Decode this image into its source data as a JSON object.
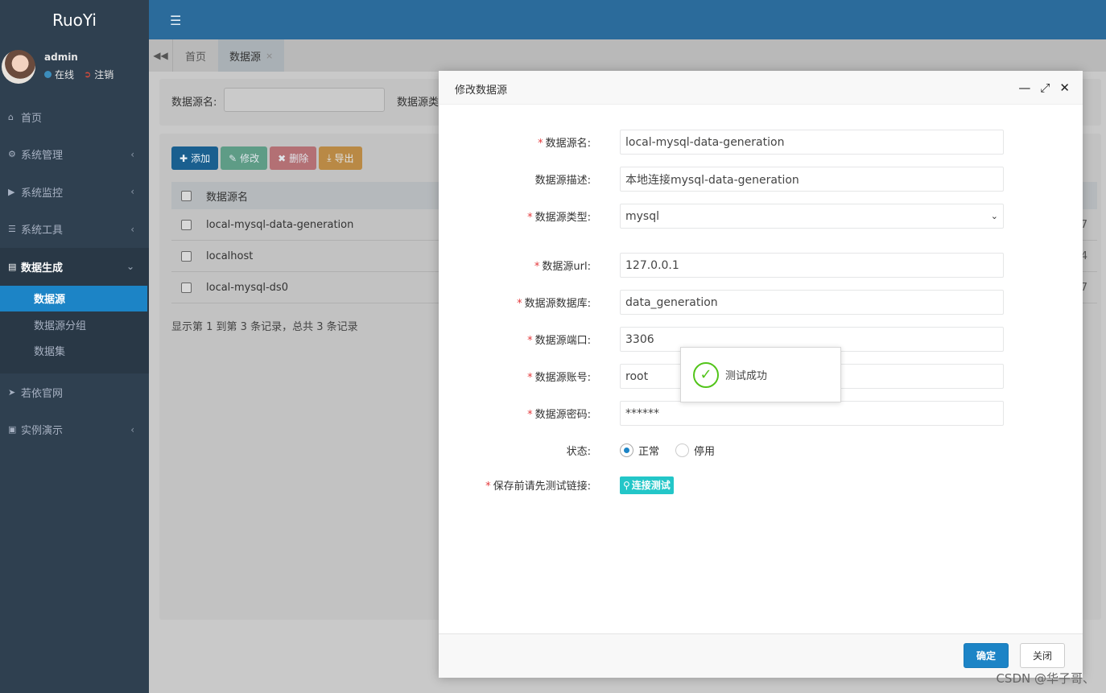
{
  "app": {
    "brand": "RuoYi"
  },
  "user": {
    "name": "admin",
    "status_online": "在线",
    "logout": "注销"
  },
  "sidebar": {
    "items": [
      {
        "label": "首页",
        "icon": "home-icon"
      },
      {
        "label": "系统管理",
        "icon": "gear-icon"
      },
      {
        "label": "系统监控",
        "icon": "video-icon"
      },
      {
        "label": "系统工具",
        "icon": "bars-icon"
      },
      {
        "label": "数据生成",
        "icon": "database-icon"
      },
      {
        "label": "若依官网",
        "icon": "send-icon"
      },
      {
        "label": "实例演示",
        "icon": "desktop-icon"
      }
    ],
    "sub_items": [
      {
        "label": "数据源"
      },
      {
        "label": "数据源分组"
      },
      {
        "label": "数据集"
      }
    ]
  },
  "tabs": [
    {
      "label": "首页"
    },
    {
      "label": "数据源"
    }
  ],
  "search": {
    "label_name": "数据源名:",
    "label_type": "数据源类"
  },
  "toolbar": {
    "add": "添加",
    "edit": "修改",
    "delete": "删除",
    "export": "导出"
  },
  "table": {
    "header": "数据源名",
    "rows": [
      {
        "name": "local-mysql-data-generation",
        "tail": "7"
      },
      {
        "name": "localhost",
        "tail": "4"
      },
      {
        "name": "local-mysql-ds0",
        "tail": "7"
      }
    ],
    "pager": "显示第 1 到第 3 条记录，总共 3 条记录"
  },
  "modal": {
    "title": "修改数据源",
    "fields": {
      "name": {
        "label": "数据源名:",
        "value": "local-mysql-data-generation"
      },
      "desc": {
        "label": "数据源描述:",
        "value": "本地连接mysql-data-generation"
      },
      "type": {
        "label": "数据源类型:",
        "value": "mysql"
      },
      "url": {
        "label": "数据源url:",
        "value": "127.0.0.1"
      },
      "database": {
        "label": "数据源数据库:",
        "value": "data_generation"
      },
      "port": {
        "label": "数据源端口:",
        "value": "3306"
      },
      "account": {
        "label": "数据源账号:",
        "value": "root"
      },
      "password": {
        "label": "数据源密码:",
        "value": "******"
      },
      "status": {
        "label": "状态:",
        "normal": "正常",
        "disabled": "停用"
      },
      "test": {
        "label": "保存前请先测试链接:",
        "button": "连接测试"
      }
    },
    "ok": "确定",
    "close": "关闭"
  },
  "toast": {
    "text": "测试成功"
  },
  "watermark": "CSDN @华子哥、",
  "colors": {
    "primary": "#1c84c6",
    "sidebar": "#2f4050",
    "info": "#23c6c8",
    "success": "#52c41a"
  }
}
